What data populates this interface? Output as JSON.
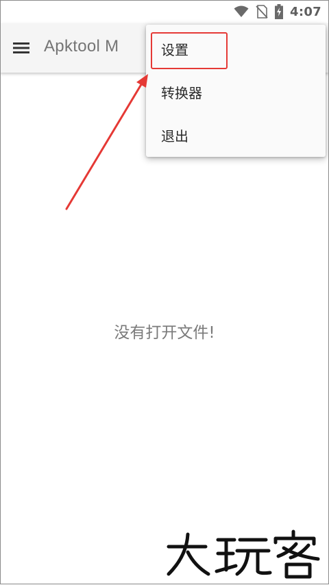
{
  "status_bar": {
    "time": "4:07",
    "icons": [
      "wifi-icon",
      "no-sim-icon",
      "battery-charging-icon"
    ]
  },
  "app_bar": {
    "title": "Apktool M",
    "menu_icon": "hamburger-menu-icon"
  },
  "overflow_menu": {
    "items": [
      {
        "label": "设置"
      },
      {
        "label": "转换器"
      },
      {
        "label": "退出"
      }
    ]
  },
  "empty_state": {
    "message": "没有打开文件!"
  },
  "watermark": {
    "text": "大玩客"
  },
  "colors": {
    "annotation": "#e53935",
    "app_bar_bg": "#f5f5f5",
    "menu_bg": "#fafafa",
    "title": "#757575"
  }
}
